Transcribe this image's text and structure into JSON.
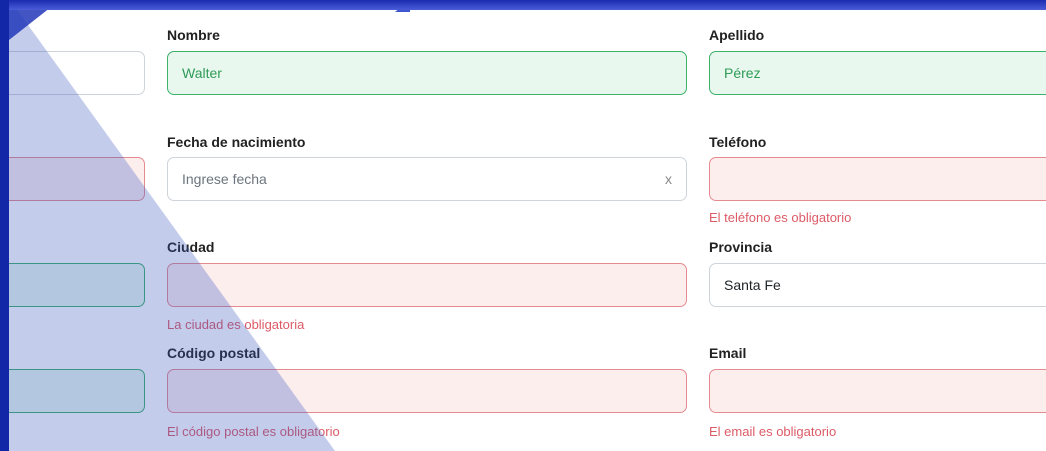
{
  "form": {
    "nombre": {
      "label": "Nombre",
      "value": "Walter"
    },
    "apellido": {
      "label": "Apellido",
      "value": "Pérez"
    },
    "fecha": {
      "label": "Fecha de nacimiento",
      "placeholder": "Ingrese fecha",
      "clear": "x"
    },
    "telefono": {
      "label": "Teléfono",
      "value": "",
      "error": "El teléfono es obligatorio"
    },
    "ciudad": {
      "label": "Ciudad",
      "value": "",
      "error": "La ciudad es obligatoria"
    },
    "provincia": {
      "label": "Provincia",
      "value": "Santa Fe"
    },
    "codigo_postal": {
      "label": "Código postal",
      "value": "",
      "error": "El código postal es obligatorio"
    },
    "email": {
      "label": "Email",
      "value": "",
      "error": "El email es obligatorio"
    }
  },
  "colors": {
    "valid_border": "#3bb16a",
    "valid_bg": "#e9f8ee",
    "invalid_border": "#e58a8f",
    "invalid_bg": "#fdeeee",
    "error_text": "#dc5b66",
    "accent_dark": "#1227a8"
  }
}
